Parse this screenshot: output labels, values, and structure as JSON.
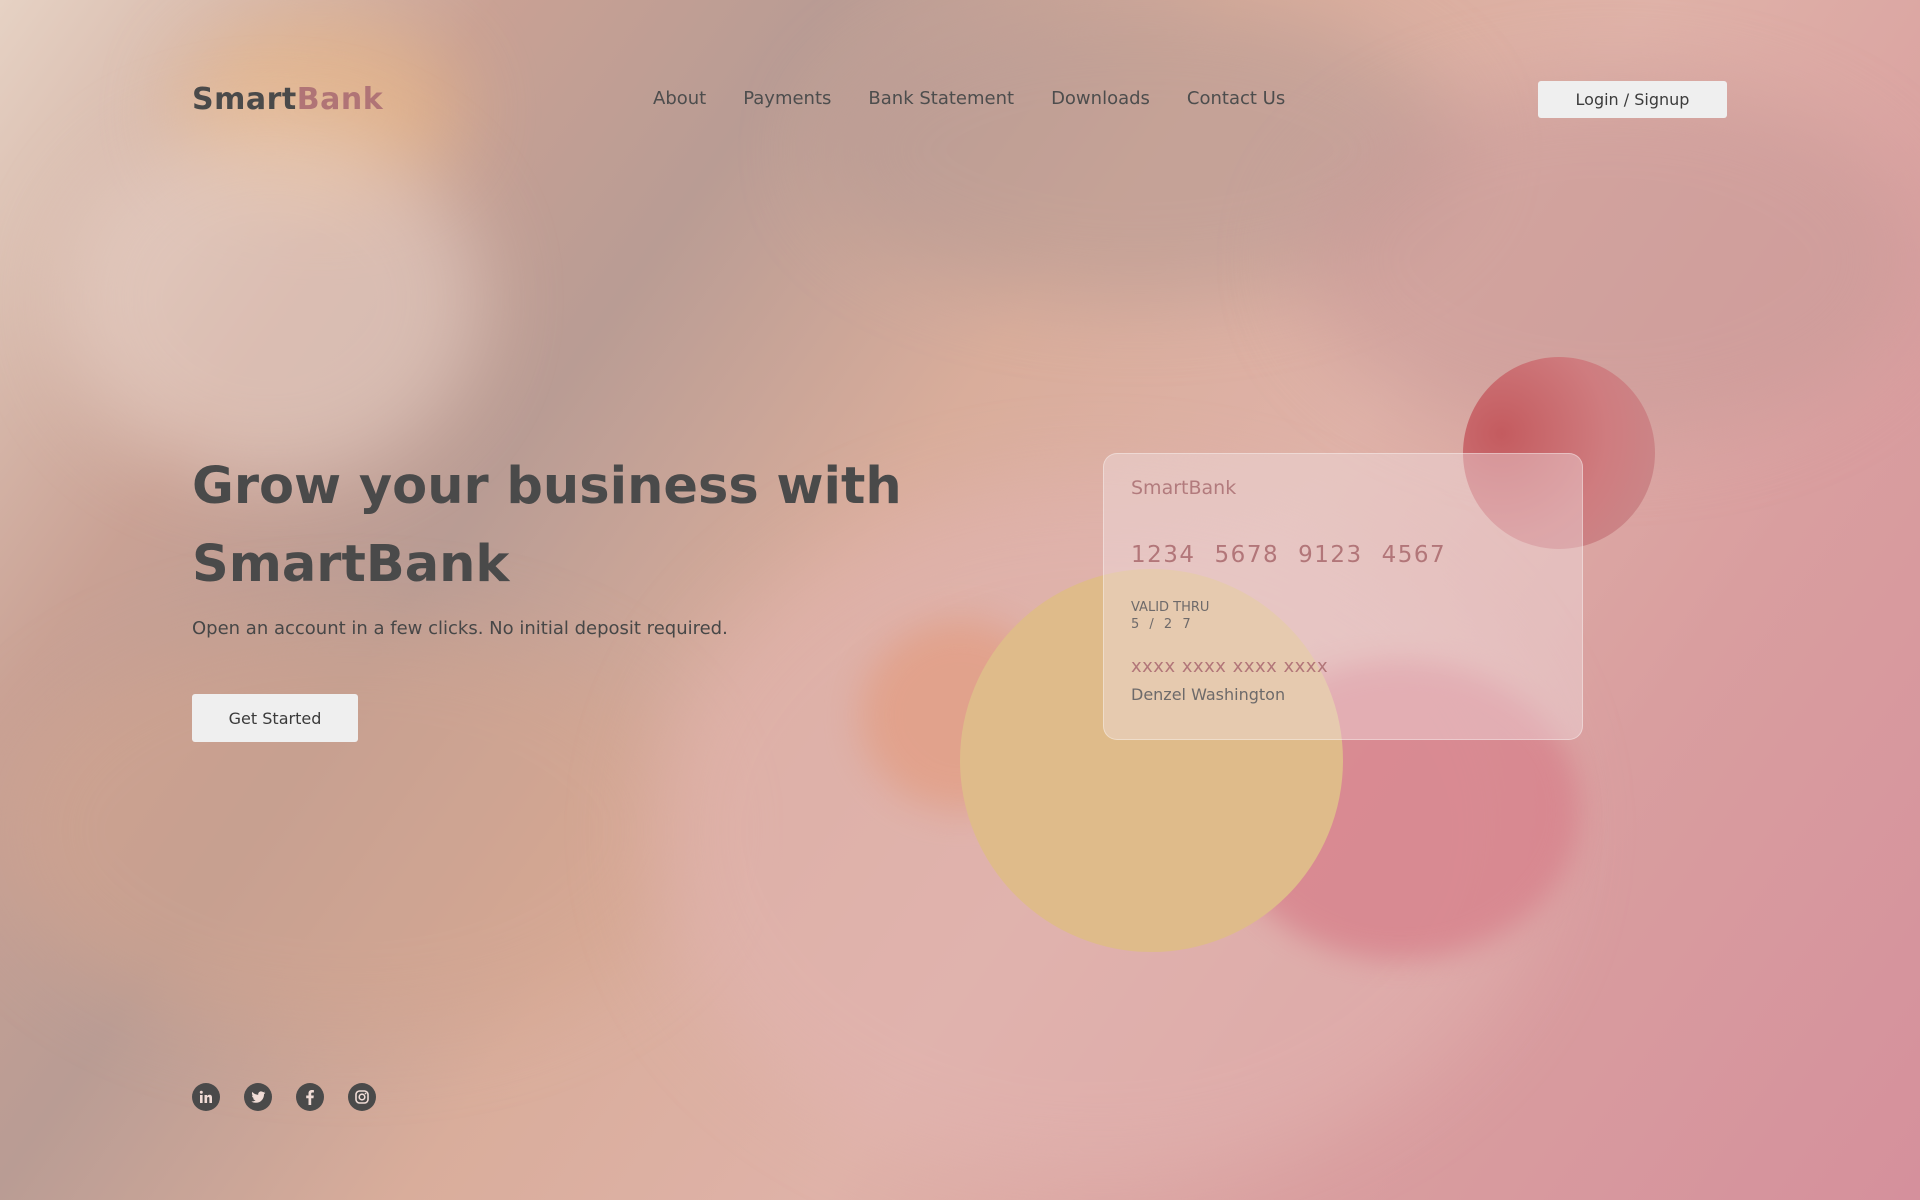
{
  "brand": {
    "name_primary": "Smart",
    "name_accent": "Bank"
  },
  "nav": {
    "items": [
      "About",
      "Payments",
      "Bank Statement",
      "Downloads",
      "Contact Us"
    ],
    "login_label": "Login / Signup"
  },
  "hero": {
    "title": "Grow your business with SmartBank",
    "subtitle": "Open an account in a few clicks. No initial deposit required.",
    "cta_label": "Get Started"
  },
  "card": {
    "brand": "SmartBank",
    "number_groups": [
      "1234",
      "5678",
      "9123",
      "4567"
    ],
    "valid_label": "VALID THRU",
    "valid_value": "5 / 2 7",
    "masked_number": "xxxx xxxx xxxx xxxx",
    "holder": "Denzel Washington"
  },
  "social": {
    "icons": [
      "linkedin-icon",
      "twitter-icon",
      "facebook-icon",
      "instagram-icon"
    ]
  },
  "colors": {
    "accent": "#b07476",
    "text_dark": "#4a4a4a",
    "button_bg": "#efefef",
    "circle_red": "#c45b5f",
    "circle_yellow": "#dfbb8a"
  }
}
